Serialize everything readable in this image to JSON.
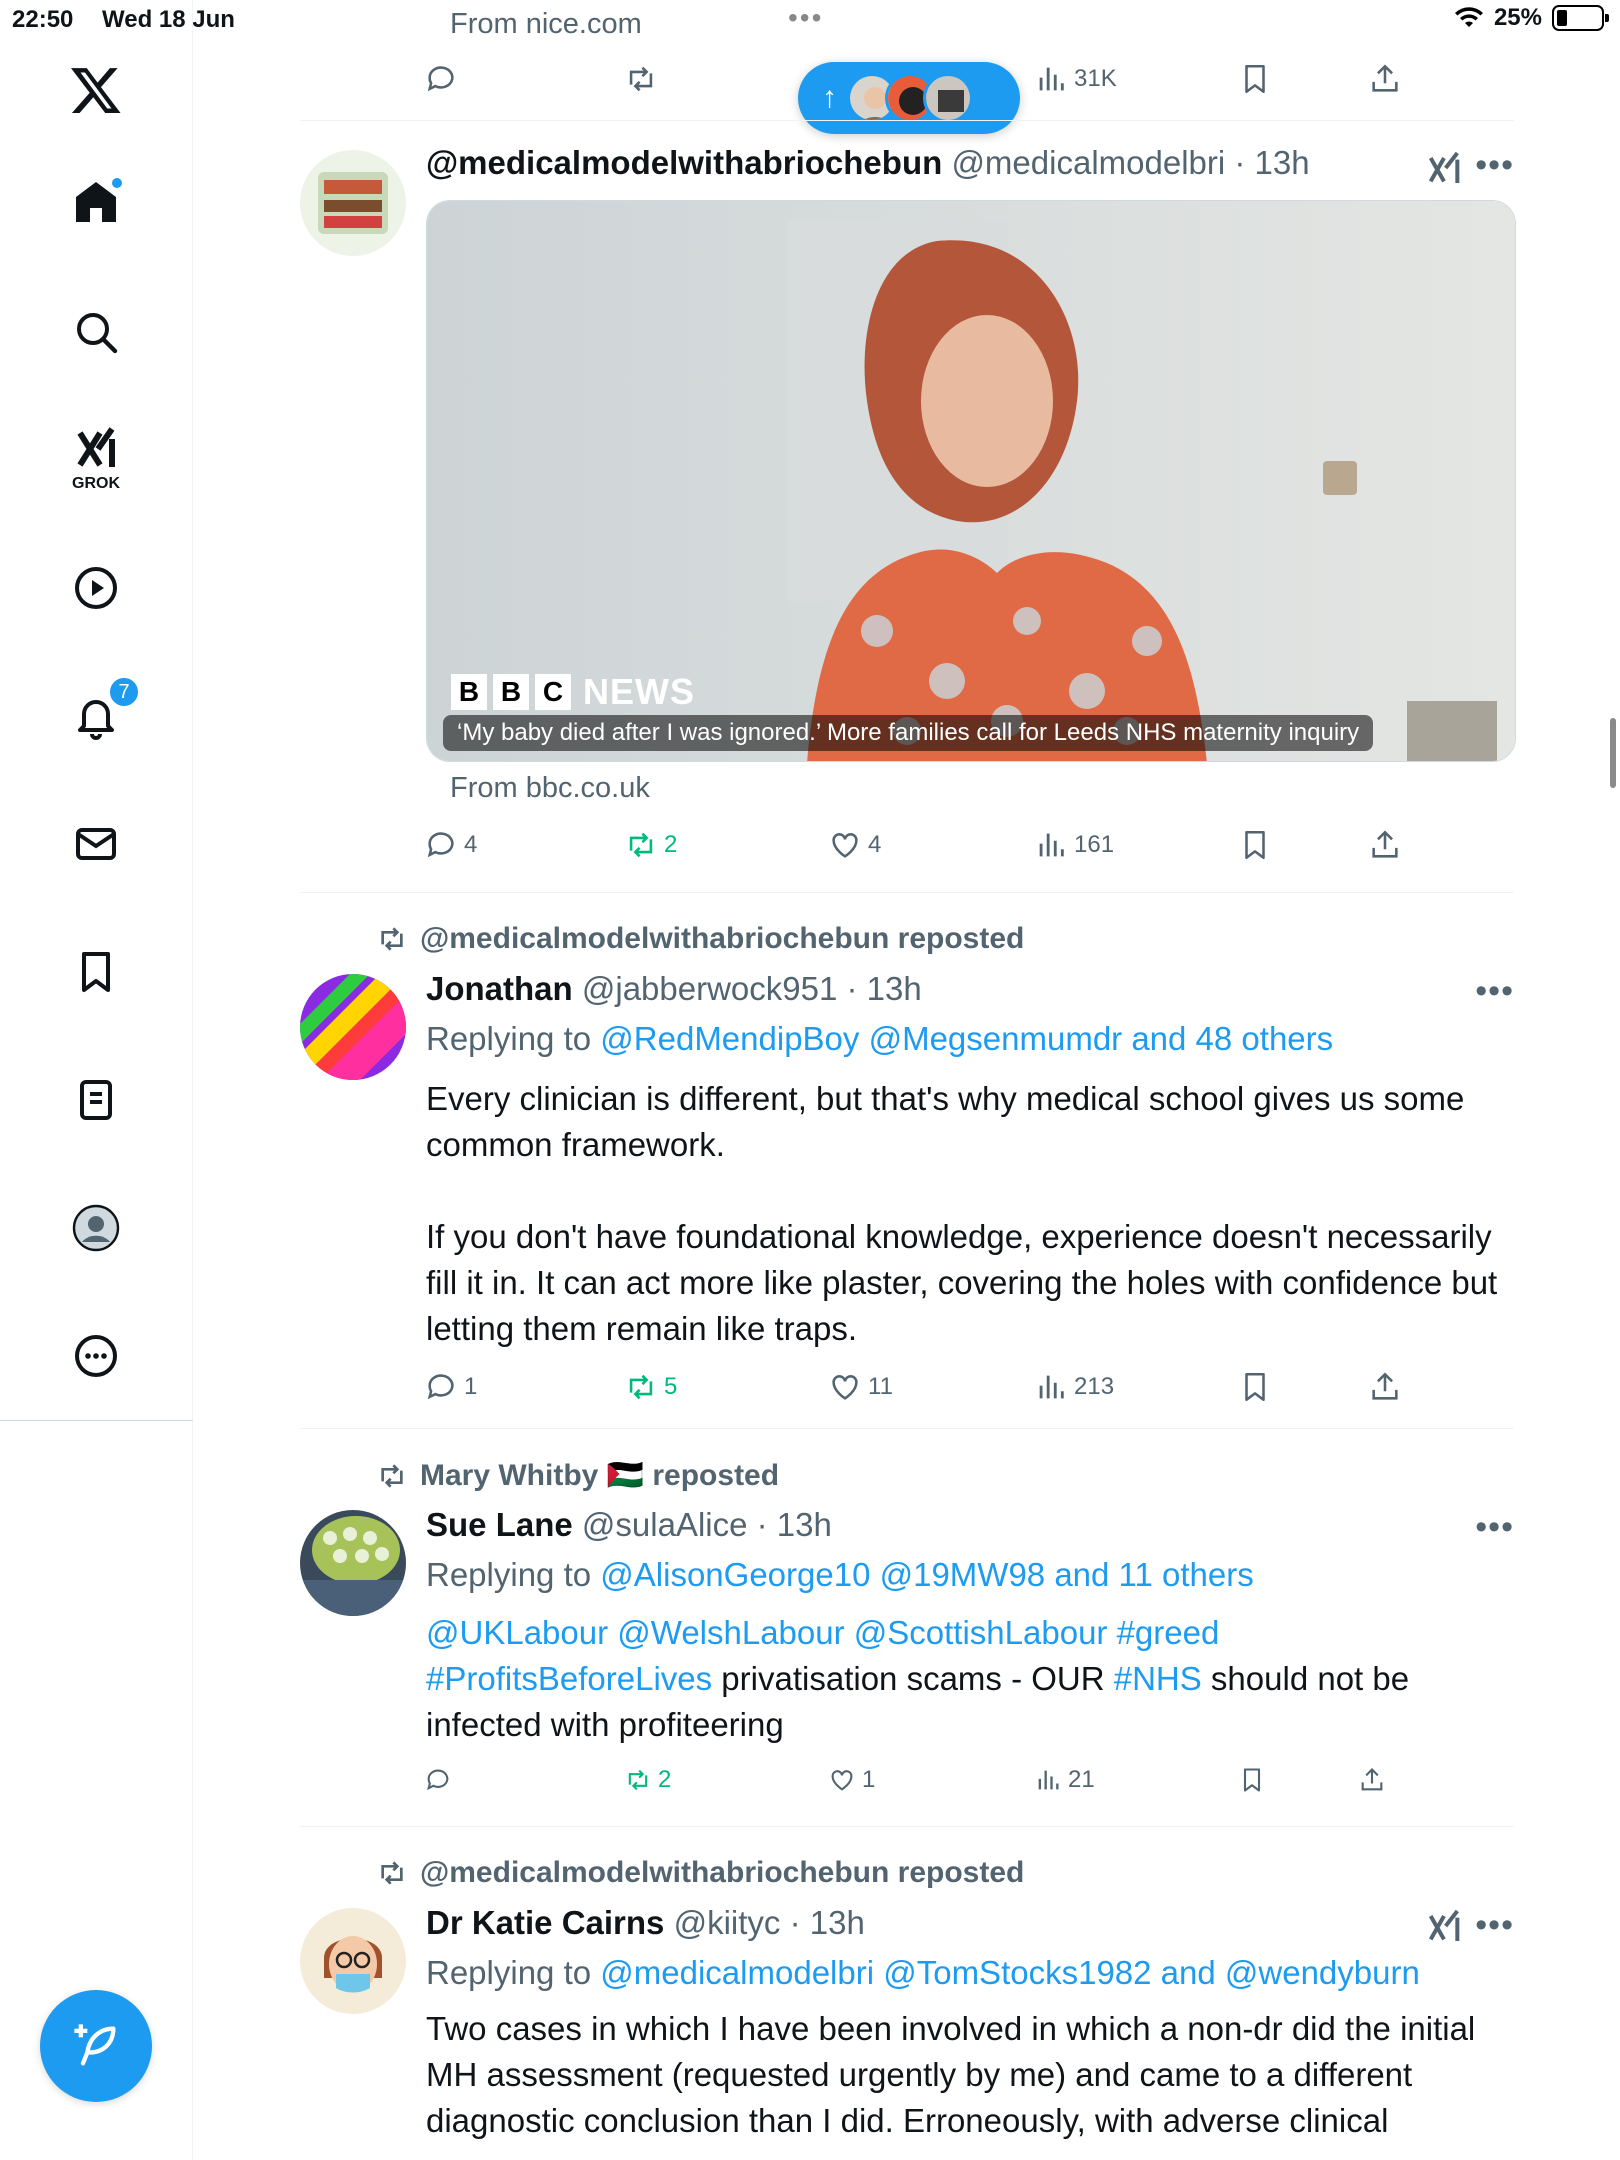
{
  "status": {
    "time": "22:50",
    "date": "Wed 18 Jun",
    "battery": "25%"
  },
  "sidebar": {
    "grok_label": "GROK",
    "notifications_count": "7"
  },
  "top_tweet": {
    "source": "From nice.com",
    "views": "31K"
  },
  "new_posts_pill": {
    "arrow": "↑"
  },
  "tweets": [
    {
      "display_name": "@medicalmodelwithabriochebun",
      "handle_time": "@medicalmodelbri · 13h",
      "media_caption": "‘My baby died after I was ignored.’ More families call for Leeds NHS maternity inquiry",
      "media_brand": "NEWS",
      "media_brand_letters": [
        "B",
        "B",
        "C"
      ],
      "source": "From bbc.co.uk",
      "replies": "4",
      "reposts": "2",
      "likes": "4",
      "views": "161"
    },
    {
      "reposted_by": "@medicalmodelwithabriochebun reposted",
      "display_name": "Jonathan",
      "handle_time": "@jabberwock951 · 13h",
      "replying_prefix": "Replying to",
      "replying_links": "@RedMendipBoy @Megsenmumdr and 48 others",
      "body_p1": "Every clinician is different, but that's why medical school gives us some common framework.",
      "body_p2": "If you don't have foundational knowledge, experience doesn't necessarily fill it in. It can act more like plaster, covering the holes with confidence but letting them remain like traps.",
      "replies": "1",
      "reposts": "5",
      "likes": "11",
      "views": "213"
    },
    {
      "reposted_by": "Mary Whitby 🇵🇸 reposted",
      "display_name": "Sue Lane",
      "handle_time": "@sulaAlice · 13h",
      "replying_prefix": "Replying to",
      "replying_links": "@AlisonGeorge10 @19MW98 and 11 others",
      "body_links1": "@UKLabour @WelshLabour @ScottishLabour #greed",
      "body_links2": "#ProfitsBeforeLives",
      "body_text2": " privatisation scams - OUR ",
      "body_links3": "#NHS",
      "body_text3": " should not be infected with profiteering",
      "replies": "",
      "reposts": "2",
      "likes": "1",
      "views": "21"
    },
    {
      "reposted_by": "@medicalmodelwithabriochebun reposted",
      "display_name": "Dr Katie Cairns",
      "handle_time": "@kiityc · 13h",
      "replying_prefix": "Replying to",
      "replying_links": "@medicalmodelbri @TomStocks1982 and @wendyburn",
      "body_p1": "Two cases in which I have been involved in which a non-dr did the initial MH assessment (requested urgently by me) and came to a different diagnostic conclusion than I did. Erroneously, with adverse clinical"
    }
  ],
  "colors": {
    "accent": "#1d9bf0",
    "repost_green": "#00ba7c",
    "muted": "#536471"
  }
}
